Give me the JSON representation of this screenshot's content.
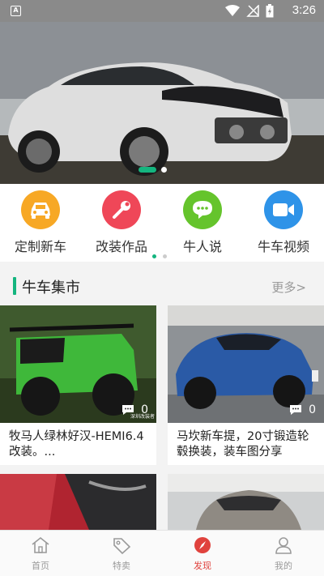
{
  "status_bar": {
    "time": "3:26",
    "app_icon_letter": "A"
  },
  "banner": {
    "slide_index": 1,
    "slide_count": 2
  },
  "menu": {
    "items": [
      {
        "label": "定制新车",
        "icon": "car-icon",
        "color": "#f7a825"
      },
      {
        "label": "改装作品",
        "icon": "wrench-icon",
        "color": "#ef4758"
      },
      {
        "label": "牛人说",
        "icon": "chat-icon",
        "color": "#65c42c"
      },
      {
        "label": "牛车视频",
        "icon": "video-icon",
        "color": "#2e93e8"
      }
    ],
    "page_count": 2,
    "page_active": 1
  },
  "section": {
    "title": "牛车集市",
    "more": "更多>"
  },
  "cards": [
    {
      "title": "牧马人绿林好汉-HEMI6.4改装。...",
      "comments": "0",
      "watermark": "深圳改装者"
    },
    {
      "title": "马坎新车提，20寸锻造轮毂换装，装车图分享",
      "comments": "0"
    },
    {
      "title": "",
      "comments": ""
    },
    {
      "title": "",
      "comments": ""
    }
  ],
  "tabbar": {
    "tabs": [
      {
        "label": "首页",
        "icon": "home-icon",
        "active": false
      },
      {
        "label": "特卖",
        "icon": "tag-icon",
        "active": false
      },
      {
        "label": "发现",
        "icon": "compass-icon",
        "active": true
      },
      {
        "label": "我的",
        "icon": "user-icon",
        "active": false
      }
    ]
  },
  "colors": {
    "accent": "#14b57f",
    "active_tab": "#e0423d"
  }
}
